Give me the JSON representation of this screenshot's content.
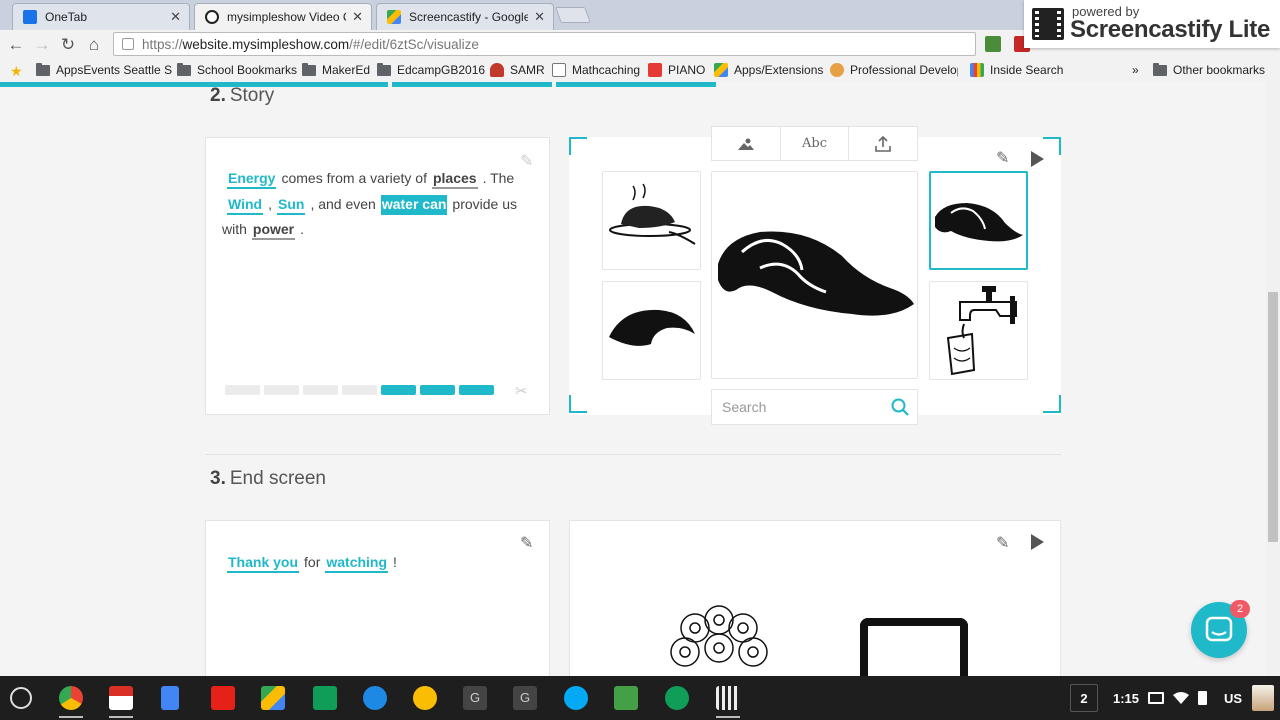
{
  "tabs": [
    {
      "title": "OneTab",
      "close": "✕",
      "favicon_color": "#1a73e8"
    },
    {
      "title": "mysimpleshow Video Cr",
      "close": "✕",
      "favicon_color": "#222222"
    },
    {
      "title": "Screencastify - Google D",
      "close": "✕",
      "favicon_color": "#34a853"
    }
  ],
  "toolbar": {
    "url_scheme": "https://",
    "url_host": "website.mysimpleshow.com",
    "url_path": "/#/edit/6ztSc/visualize"
  },
  "bookmarks": [
    {
      "label": "AppsEvents Seattle S",
      "icon": "folder-icon"
    },
    {
      "label": "School Bookmarks",
      "icon": "folder-icon"
    },
    {
      "label": "MakerEd",
      "icon": "folder-icon"
    },
    {
      "label": "EdcampGB2016",
      "icon": "folder-icon"
    },
    {
      "label": "SAMR",
      "icon": "samr-icon"
    },
    {
      "label": "Mathcaching",
      "icon": "page-icon"
    },
    {
      "label": "PIANO",
      "icon": "piano-icon"
    },
    {
      "label": "Apps/Extensions",
      "icon": "drive-icon"
    },
    {
      "label": "Professional Develop",
      "icon": "pd-icon"
    },
    {
      "label": "Inside Search",
      "icon": "google-icon"
    }
  ],
  "bookmarks_more": "»",
  "other_bookmarks": "Other bookmarks",
  "screencastify": {
    "powered_by": "powered by",
    "brand": "Screencastify Lite"
  },
  "story": {
    "number": "2.",
    "title": "Story",
    "text_energy": "Energy",
    "text_1": "comes from a variety of",
    "text_places": "places",
    "text_2": ". The",
    "text_wind": "Wind",
    "text_3": ",",
    "text_sun": "Sun",
    "text_4": ", and even",
    "text_water": "water can",
    "text_5": "provide us",
    "text_6": "with",
    "text_power": "power",
    "text_7": ".",
    "segments_active_from": 4,
    "segments_total": 7
  },
  "visual_panel": {
    "tabs": [
      {
        "name": "image-tab",
        "label": ""
      },
      {
        "name": "text-tab",
        "label": "Abc"
      },
      {
        "name": "upload-tab",
        "label": ""
      }
    ],
    "search_placeholder": "Search",
    "selected_tile": "wave-right"
  },
  "end_screen": {
    "number": "3.",
    "title": "End screen",
    "text_thanks": "Thank you",
    "text_for": "for",
    "text_watching": "watching",
    "text_bang": "!"
  },
  "chat_badge": "2",
  "shelf": {
    "apps": [
      "chrome-icon",
      "gmail-icon",
      "docs-icon",
      "youtube-icon",
      "drive-icon",
      "classroom-icon",
      "files-icon",
      "keep-icon",
      "g-icon",
      "g-icon",
      "camera-icon",
      "cast-icon",
      "sheets-icon",
      "video-icon"
    ],
    "desk_count": "2",
    "time": "1:15",
    "locale": "US"
  },
  "colors": {
    "accent": "#1fb9c9",
    "badge": "#f05a67"
  }
}
